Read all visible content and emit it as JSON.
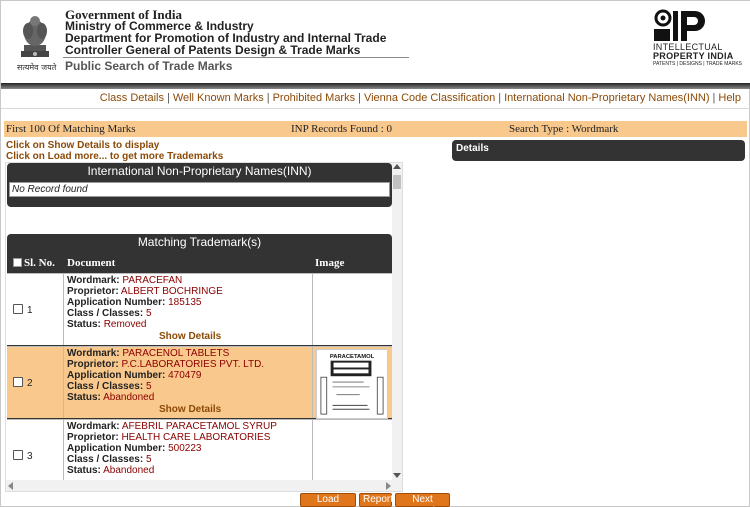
{
  "header": {
    "line1": "Government of India",
    "line2": "Ministry of Commerce & Industry",
    "line3": "Department for Promotion of Industry and Internal Trade",
    "line4": "Controller General of Patents Design & Trade Marks",
    "line5": "Public Search of Trade Marks",
    "emblem_caption": "सत्यमेव जयते",
    "ip_text1": "INTELLECTUAL",
    "ip_text2": "PROPERTY INDIA",
    "ip_text3": "PATENTS | DESIGNS | TRADE MARKS"
  },
  "nav": {
    "items": [
      "Class Details",
      "Well Known Marks",
      "Prohibited Marks",
      "Vienna Code Classification",
      "International Non-Proprietary Names(INN)",
      "Help"
    ]
  },
  "infobar": {
    "left": "First 100 Of Matching Marks",
    "middle": "INP Records Found : 0",
    "right": "Search Type : Wordmark"
  },
  "hints": {
    "show_details": "Click on Show Details to display",
    "load_more": "Click on Load more... to get more Trademarks"
  },
  "details": {
    "title": "Details"
  },
  "inn": {
    "title": "International Non-Proprietary Names(INN)",
    "empty": "No Record found"
  },
  "trademarks": {
    "title": "Matching Trademark(s)",
    "columns": {
      "sl": "Sl. No.",
      "doc": "Document",
      "img": "Image"
    },
    "labels": {
      "wordmark": "Wordmark:",
      "proprietor": "Proprietor:",
      "appno": "Application Number:",
      "class": "Class / Classes:",
      "status": "Status:"
    },
    "show_details": "Show Details",
    "rows": [
      {
        "sl": "1",
        "wordmark": "PARACEFAN",
        "proprietor": "ALBERT BOCHRINGE",
        "appno": "185135",
        "class": "5",
        "status": "Removed"
      },
      {
        "sl": "2",
        "wordmark": "PARACENOL TABLETS",
        "proprietor": "P.C.LABORATORIES PVT. LTD.",
        "appno": "470479",
        "class": "5",
        "status": "Abandoned"
      },
      {
        "sl": "3",
        "wordmark": "AFEBRIL PARACETAMOL SYRUP",
        "proprietor": "HEALTH CARE LABORATORIES",
        "appno": "500223",
        "class": "5",
        "status": "Abandoned"
      }
    ],
    "thumbnail_text": "PARACETAMOL"
  },
  "buttons": {
    "load_more": "Load More...",
    "report": "Report",
    "next_search": "Next Search"
  }
}
